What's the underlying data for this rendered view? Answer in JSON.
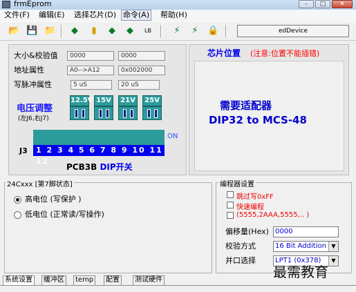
{
  "window": {
    "title": "frmEprom"
  },
  "menu": [
    "文件(F)",
    "编辑(E)",
    "选择芯片(D)",
    "命令(A)",
    "帮助(H)"
  ],
  "toolbar": {
    "device": "edDevice",
    "lb": "LB"
  },
  "info": {
    "size_label": "大小&校验值",
    "size_val1": "0000",
    "size_val2": "0000",
    "addr_label": "地址属性",
    "addr_val1": "A0-->A12",
    "addr_val2": "0x002000",
    "pulse_label": "写脉冲属性",
    "pulse_val1": "5 uS",
    "pulse_val2": "20 uS"
  },
  "voltage": {
    "title": "电压调整",
    "hint": "(左J6,右J7)",
    "levels": [
      "12.5V",
      "15V",
      "21V",
      "25V"
    ]
  },
  "dip": {
    "on": "ON",
    "j3": "J3",
    "numbers": "1 2 3 4 5 6 7 8 9 10 11 12",
    "title_prefix": "PCB3B",
    "title_suffix": "DIP开关"
  },
  "chip": {
    "title": "芯片位置",
    "note": "(注意:位置不能插错)",
    "adapter_line1": "需要适配器",
    "adapter_line2": "DIP32 to MCS-48"
  },
  "pin7": {
    "title": "24Cxxx [第7脚状态]",
    "high": "高电位 (写保护 )",
    "low": "低电位 (正常读/写操作)"
  },
  "prog": {
    "title": "编程器设置",
    "skip": "跳过写0xFF",
    "fast": "快速编程",
    "pattern": "(5555,2AAA,5555,.. )",
    "offset_label": "偏移量(Hex)",
    "offset_value": "0000",
    "verify_label": "校验方式",
    "verify_value": "16 Bit Addition",
    "port_label": "并口选择",
    "port_value": "LPT1 (0x378)"
  },
  "tabs": [
    "系统设置",
    "缓冲区",
    "temp",
    "配置",
    "测试硬件"
  ],
  "watermark": "最需教育",
  "colors": {
    "teal": "#2b9b9b",
    "blue": "#0000ee",
    "red": "#ff0000"
  }
}
